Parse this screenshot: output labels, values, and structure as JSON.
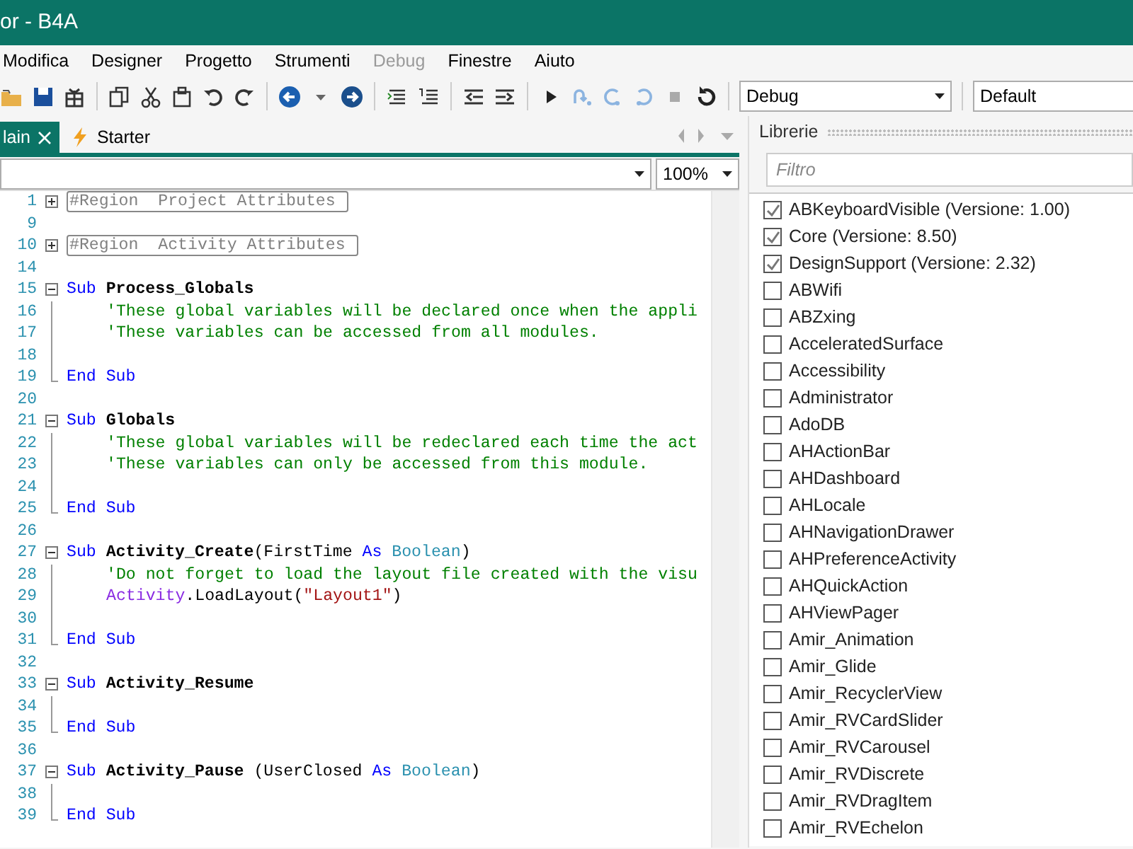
{
  "window": {
    "title": "or - B4A"
  },
  "menu": [
    {
      "label": "Modifica",
      "disabled": false
    },
    {
      "label": "Designer",
      "disabled": false
    },
    {
      "label": "Progetto",
      "disabled": false
    },
    {
      "label": "Strumenti",
      "disabled": false
    },
    {
      "label": "Debug",
      "disabled": true
    },
    {
      "label": "Finestre",
      "disabled": false
    },
    {
      "label": "Aiuto",
      "disabled": false
    }
  ],
  "toolbar": {
    "build_config": "Debug",
    "device": "Default"
  },
  "tabs": [
    {
      "label": "lain",
      "selected": true,
      "closable": true
    },
    {
      "label": "Starter",
      "selected": false,
      "closable": false
    }
  ],
  "editor": {
    "zoom": "100%",
    "lines": [
      {
        "number": "1",
        "collapsed": true,
        "tokens": [
          {
            "kind": "region",
            "text": "#Region  Project Attributes "
          }
        ]
      },
      {
        "number": "9"
      },
      {
        "number": "10",
        "collapsed": true,
        "tokens": [
          {
            "kind": "region",
            "text": "#Region  Activity Attributes "
          }
        ]
      },
      {
        "number": "14"
      },
      {
        "number": "15",
        "collapsed": false,
        "tokens": [
          {
            "kind": "keyword",
            "text": "Sub "
          },
          {
            "kind": "name",
            "text": "Process_Globals"
          }
        ],
        "children": [
          {
            "number": "16",
            "indented": true,
            "tokens": [
              {
                "kind": "comment",
                "text": "'These global variables will be declared once when the appli"
              }
            ]
          },
          {
            "number": "17",
            "indented": true,
            "tokens": [
              {
                "kind": "comment",
                "text": "'These variables can be accessed from all modules."
              }
            ]
          },
          {
            "number": "18"
          },
          {
            "number": "19",
            "tokens": [
              {
                "kind": "keyword",
                "text": "End Sub"
              }
            ]
          }
        ]
      },
      {
        "number": "20"
      },
      {
        "number": "21",
        "collapsed": false,
        "tokens": [
          {
            "kind": "keyword",
            "text": "Sub "
          },
          {
            "kind": "name",
            "text": "Globals"
          }
        ],
        "children": [
          {
            "number": "22",
            "indented": true,
            "tokens": [
              {
                "kind": "comment",
                "text": "'These global variables will be redeclared each time the act"
              }
            ]
          },
          {
            "number": "23",
            "indented": true,
            "tokens": [
              {
                "kind": "comment",
                "text": "'These variables can only be accessed from this module."
              }
            ]
          },
          {
            "number": "24"
          },
          {
            "number": "25",
            "tokens": [
              {
                "kind": "keyword",
                "text": "End Sub"
              }
            ]
          }
        ]
      },
      {
        "number": "26"
      },
      {
        "number": "27",
        "collapsed": false,
        "tokens": [
          {
            "kind": "keyword",
            "text": "Sub "
          },
          {
            "kind": "name",
            "text": "Activity_Create"
          },
          {
            "kind": "plain",
            "text": "(FirstTime "
          },
          {
            "kind": "keyword",
            "text": "As "
          },
          {
            "kind": "type",
            "text": "Boolean"
          },
          {
            "kind": "plain",
            "text": ")"
          }
        ],
        "children": [
          {
            "number": "28",
            "indented": true,
            "tokens": [
              {
                "kind": "comment",
                "text": "'Do not forget to load the layout file created with the visu"
              }
            ]
          },
          {
            "number": "29",
            "indented": true,
            "tokens": [
              {
                "kind": "object",
                "text": "Activity"
              },
              {
                "kind": "plain",
                "text": ".LoadLayout("
              },
              {
                "kind": "string",
                "text": "\"Layout1\""
              },
              {
                "kind": "plain",
                "text": ")"
              }
            ]
          },
          {
            "number": "30"
          },
          {
            "number": "31",
            "tokens": [
              {
                "kind": "keyword",
                "text": "End Sub"
              }
            ]
          }
        ]
      },
      {
        "number": "32"
      },
      {
        "number": "33",
        "collapsed": false,
        "tokens": [
          {
            "kind": "keyword",
            "text": "Sub "
          },
          {
            "kind": "name",
            "text": "Activity_Resume"
          }
        ],
        "children": [
          {
            "number": "34"
          },
          {
            "number": "35",
            "tokens": [
              {
                "kind": "keyword",
                "text": "End Sub"
              }
            ]
          }
        ]
      },
      {
        "number": "36"
      },
      {
        "number": "37",
        "collapsed": false,
        "tokens": [
          {
            "kind": "keyword",
            "text": "Sub "
          },
          {
            "kind": "name",
            "text": "Activity_Pause"
          },
          {
            "kind": "plain",
            "text": " (UserClosed "
          },
          {
            "kind": "keyword",
            "text": "As "
          },
          {
            "kind": "type",
            "text": "Boolean"
          },
          {
            "kind": "plain",
            "text": ")"
          }
        ],
        "children": [
          {
            "number": "38"
          },
          {
            "number": "39",
            "tokens": [
              {
                "kind": "keyword",
                "text": "End Sub"
              }
            ]
          }
        ]
      }
    ]
  },
  "libraries_panel": {
    "title": "Librerie",
    "filter_placeholder": "Filtro",
    "items": [
      {
        "name": "ABKeyboardVisible (Versione: 1.00)",
        "checked": true
      },
      {
        "name": "Core (Versione: 8.50)",
        "checked": true
      },
      {
        "name": "DesignSupport (Versione: 2.32)",
        "checked": true
      },
      {
        "name": "ABWifi",
        "checked": false
      },
      {
        "name": "ABZxing",
        "checked": false
      },
      {
        "name": "AcceleratedSurface",
        "checked": false
      },
      {
        "name": "Accessibility",
        "checked": false
      },
      {
        "name": "Administrator",
        "checked": false
      },
      {
        "name": "AdoDB",
        "checked": false
      },
      {
        "name": "AHActionBar",
        "checked": false
      },
      {
        "name": "AHDashboard",
        "checked": false
      },
      {
        "name": "AHLocale",
        "checked": false
      },
      {
        "name": "AHNavigationDrawer",
        "checked": false
      },
      {
        "name": "AHPreferenceActivity",
        "checked": false
      },
      {
        "name": "AHQuickAction",
        "checked": false
      },
      {
        "name": "AHViewPager",
        "checked": false
      },
      {
        "name": "Amir_Animation",
        "checked": false
      },
      {
        "name": "Amir_Glide",
        "checked": false
      },
      {
        "name": "Amir_RecyclerView",
        "checked": false
      },
      {
        "name": "Amir_RVCardSlider",
        "checked": false
      },
      {
        "name": "Amir_RVCarousel",
        "checked": false
      },
      {
        "name": "Amir_RVDiscrete",
        "checked": false
      },
      {
        "name": "Amir_RVDragItem",
        "checked": false
      },
      {
        "name": "Amir_RVEchelon",
        "checked": false
      }
    ]
  }
}
